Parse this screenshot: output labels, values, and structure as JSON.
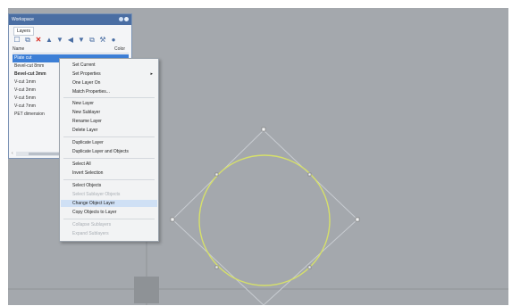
{
  "panel": {
    "title": "Workspace",
    "tab": "Layers",
    "col_name": "Name",
    "col_color": "Color",
    "layers": [
      {
        "label": "Plate cut",
        "selected": true,
        "bold": false
      },
      {
        "label": "Bevel-cut 8mm",
        "selected": false,
        "bold": false
      },
      {
        "label": "Bevel-cut 3mm",
        "selected": false,
        "bold": true
      },
      {
        "label": "V-cut 1mm",
        "selected": false,
        "bold": false
      },
      {
        "label": "V-cut 3mm",
        "selected": false,
        "bold": false
      },
      {
        "label": "V-cut 5mm",
        "selected": false,
        "bold": false
      },
      {
        "label": "V-cut 7mm",
        "selected": false,
        "bold": false
      },
      {
        "label": "PET dimension",
        "selected": false,
        "bold": false
      }
    ],
    "scroll_left": "‹"
  },
  "toolbar": {
    "icons": [
      "new-layer-icon",
      "new-sublayer-icon",
      "delete-icon",
      "move-up-icon",
      "move-down-icon",
      "filter-icon",
      "funnel-icon",
      "copy-icon",
      "tools-icon",
      "help-icon"
    ],
    "glyphs": [
      "☐",
      "⧉",
      "✕",
      "▲",
      "▼",
      "◀",
      "▼",
      "⧉",
      "⚒",
      "●"
    ]
  },
  "menu": {
    "items": [
      {
        "label": "Set Current",
        "disabled": false
      },
      {
        "label": "Set Properties",
        "disabled": false,
        "submenu": true
      },
      {
        "label": "One Layer On",
        "disabled": false
      },
      {
        "label": "Match Properties...",
        "disabled": false
      },
      {
        "label": "New Layer",
        "disabled": false
      },
      {
        "label": "New Sublayer",
        "disabled": false
      },
      {
        "label": "Rename Layer",
        "disabled": false
      },
      {
        "label": "Delete Layer",
        "disabled": false
      },
      {
        "label": "Duplicate Layer",
        "disabled": false
      },
      {
        "label": "Duplicate Layer and Objects",
        "disabled": false
      },
      {
        "label": "Select All",
        "disabled": false
      },
      {
        "label": "Invert Selection",
        "disabled": false
      },
      {
        "label": "Select Objects",
        "disabled": false
      },
      {
        "label": "Select Sublayer Objects",
        "disabled": true
      },
      {
        "label": "Change Object Layer",
        "disabled": false,
        "highlighted": true
      },
      {
        "label": "Copy Objects to Layer",
        "disabled": false
      },
      {
        "label": "Collapse Sublayers",
        "disabled": true
      },
      {
        "label": "Expand Sublayers",
        "disabled": true
      }
    ],
    "submenu_arrow": "▸"
  },
  "colors": {
    "viewport_bg": "#a4a8ad",
    "circle": "#d6e06a",
    "diamond": "#bfc3c8",
    "selection": "#3d7fd6",
    "menu_highlight": "#cfe0f5"
  }
}
